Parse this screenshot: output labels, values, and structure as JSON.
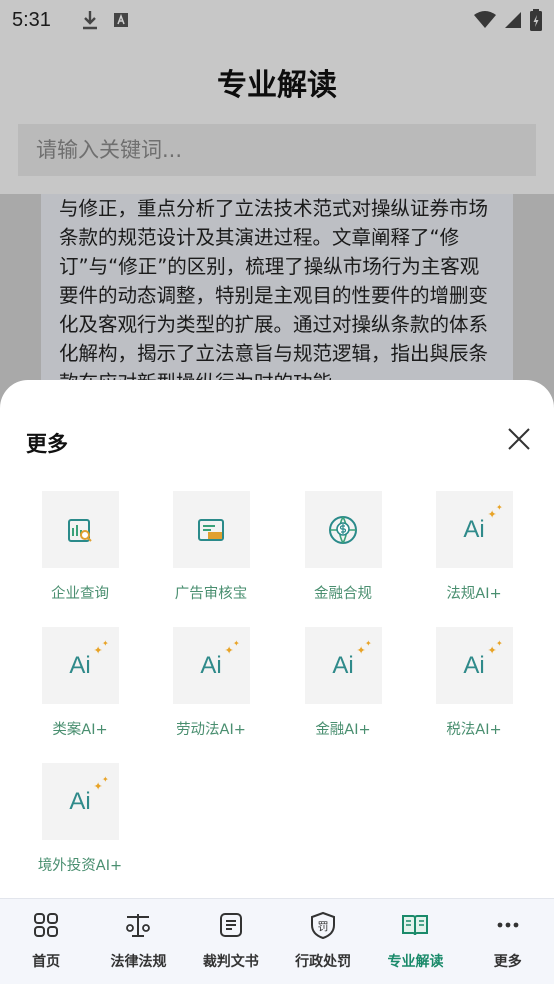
{
  "status_bar": {
    "time": "5:31"
  },
  "header": {
    "title": "专业解读"
  },
  "search": {
    "placeholder": "请输入关键词..."
  },
  "article": {
    "text": "与修正，重点分析了立法技术范式对操纵证券市场条款的规范设计及其演进过程。文章阐释了“修订”与“修正”的区别，梳理了操纵市场行为主客观要件的动态调整，特别是主观目的性要件的增删变化及客观行为类型的扩展。通过对操纵条款的体系化解构，揭示了立法意旨与规范逻辑，指出與辰条款在应对新型操纵行为时的功能"
  },
  "sheet": {
    "title": "更多",
    "items": [
      {
        "label": "企业查询",
        "icon": "company-search-icon"
      },
      {
        "label": "广告审核宝",
        "icon": "ad-check-icon"
      },
      {
        "label": "金融合规",
        "icon": "finance-globe-icon"
      },
      {
        "label": "法规AI+",
        "icon": "ai-icon"
      },
      {
        "label": "类案AI+",
        "icon": "ai-icon"
      },
      {
        "label": "劳动法AI+",
        "icon": "ai-icon"
      },
      {
        "label": "金融AI+",
        "icon": "ai-icon"
      },
      {
        "label": "税法AI+",
        "icon": "ai-icon"
      },
      {
        "label": "境外投资AI+",
        "icon": "ai-icon"
      }
    ],
    "ai_text": "Ai"
  },
  "nav": {
    "items": [
      {
        "label": "首页",
        "icon": "home-grid-icon"
      },
      {
        "label": "法律法规",
        "icon": "scales-icon"
      },
      {
        "label": "裁判文书",
        "icon": "document-icon"
      },
      {
        "label": "行政处罚",
        "icon": "shield-penalty-icon"
      },
      {
        "label": "专业解读",
        "icon": "open-book-icon"
      },
      {
        "label": "更多",
        "icon": "more-dots-icon"
      }
    ],
    "active_index": 4,
    "penalty_glyph": "罚"
  },
  "colors": {
    "accent": "#1a8a6a",
    "label_green": "#4a8f70",
    "ai_teal": "#2f8a8a",
    "ai_star": "#e8a326"
  }
}
